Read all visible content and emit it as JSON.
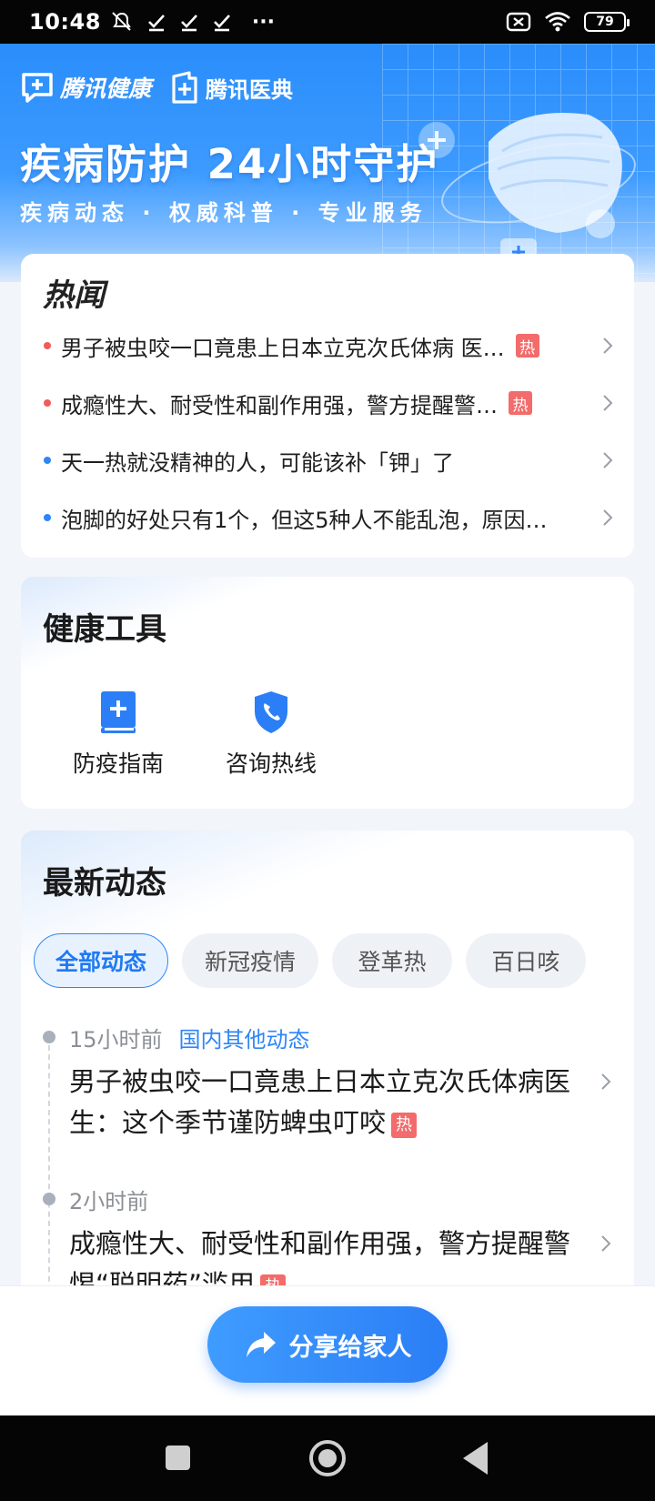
{
  "status_bar": {
    "time": "10:48",
    "more_dots": "···",
    "battery": "79"
  },
  "hero": {
    "logo1": "腾讯健康",
    "logo2": "腾讯医典",
    "title": "疾病防护 24小时守护",
    "subtitle": "疾病动态 · 权威科普 · 专业服务"
  },
  "news": {
    "title": "热闻",
    "items": [
      {
        "text": "男子被虫咬一口竟患上日本立克次氏体病 医…",
        "hot": "热",
        "dot_color": "#f15b5b"
      },
      {
        "text": "成瘾性大、耐受性和副作用强，警方提醒警…",
        "hot": "热",
        "dot_color": "#f15b5b"
      },
      {
        "text": "天一热就没精神的人，可能该补「钾」了",
        "hot": "",
        "dot_color": "#2f86f6"
      },
      {
        "text": "泡脚的好处只有1个，但这5种人不能乱泡，原因…",
        "hot": "",
        "dot_color": "#2f86f6"
      }
    ]
  },
  "tools": {
    "title": "健康工具",
    "items": [
      {
        "label": "防疫指南",
        "icon": "medical-book-icon"
      },
      {
        "label": "咨询热线",
        "icon": "phone-shield-icon"
      }
    ]
  },
  "dynamics": {
    "title": "最新动态",
    "tabs": [
      {
        "label": "全部动态",
        "active": true
      },
      {
        "label": "新冠疫情",
        "active": false
      },
      {
        "label": "登革热",
        "active": false
      },
      {
        "label": "百日咳",
        "active": false
      }
    ],
    "items": [
      {
        "time": "15小时前",
        "category": "国内其他动态",
        "title": "男子被虫咬一口竟患上日本立克次氏体病医生：这个季节谨防蜱虫叮咬",
        "hot": "热"
      },
      {
        "time": "2小时前",
        "category": "",
        "title": "成瘾性大、耐受性和副作用强，警方提醒警惕“聪明药”滥用",
        "hot": "热"
      }
    ]
  },
  "share": {
    "label": "分享给家人"
  },
  "colors": {
    "accent": "#2f86f6",
    "hot": "#f36b6b",
    "hero_top": "#2a8dfb"
  }
}
